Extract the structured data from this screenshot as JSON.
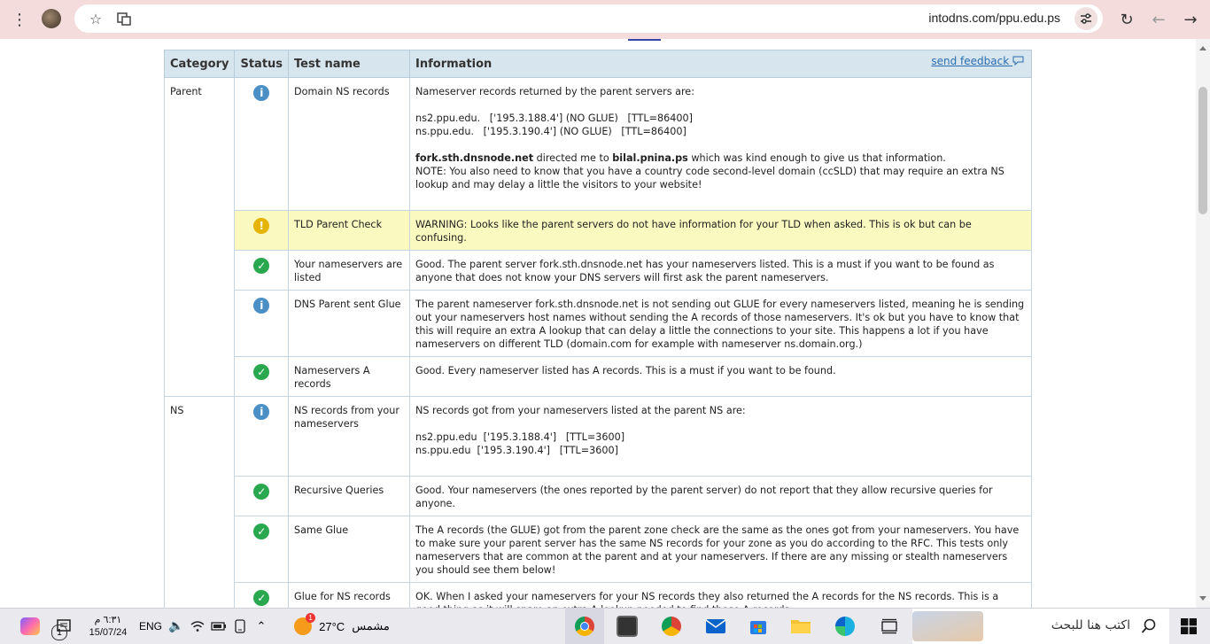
{
  "browser": {
    "url": "intodns.com/ppu.edu.ps"
  },
  "table": {
    "headers": {
      "category": "Category",
      "status": "Status",
      "test": "Test name",
      "info": "Information"
    },
    "feedback_link": "send feedback",
    "rows": [
      {
        "category": "Parent",
        "status": "info",
        "test": "Domain NS records",
        "lines": [
          "Nameserver records returned by the parent servers are:",
          "",
          "ns2.ppu.edu.   ['195.3.188.4'] (NO GLUE)   [TTL=86400]",
          "ns.ppu.edu.   ['195.3.190.4'] (NO GLUE)   [TTL=86400]",
          ""
        ],
        "directed": {
          "server": "fork.sth.dnsnode.net",
          "middle": " directed me to ",
          "target": "bilal.pnina.ps",
          "tail": " which was kind enough to give us that information."
        },
        "note": "NOTE: You also need to know that you have a country code second-level domain (ccSLD) that may require an extra NS lookup and may delay a little the visitors to your website!"
      },
      {
        "category": "",
        "status": "warn",
        "test": "TLD Parent Check",
        "text": "WARNING: Looks like the parent servers do not have information for your TLD when asked. This is ok but can be confusing."
      },
      {
        "category": "",
        "status": "ok",
        "test": "Your nameservers are listed",
        "text": "Good. The parent server fork.sth.dnsnode.net has your nameservers listed. This is a must if you want to be found as anyone that does not know your DNS servers will first ask the parent nameservers."
      },
      {
        "category": "",
        "status": "info",
        "test": "DNS Parent sent Glue",
        "text": "The parent nameserver fork.sth.dnsnode.net is not sending out GLUE for every nameservers listed, meaning he is sending out your nameservers host names without sending the A records of those nameservers. It's ok but you have to know that this will require an extra A lookup that can delay a little the connections to your site. This happens a lot if you have nameservers on different TLD (domain.com for example with nameserver ns.domain.org.)"
      },
      {
        "category": "",
        "status": "ok",
        "test": "Nameservers A records",
        "text": "Good. Every nameserver listed has A records. This is a must if you want to be found."
      },
      {
        "category": "NS",
        "status": "info",
        "test": "NS records from your nameservers",
        "lines": [
          "NS records got from your nameservers listed at the parent NS are:",
          "",
          "ns2.ppu.edu  ['195.3.188.4']   [TTL=3600]",
          "ns.ppu.edu  ['195.3.190.4']   [TTL=3600]"
        ]
      },
      {
        "category": "",
        "status": "ok",
        "test": "Recursive Queries",
        "text": "Good. Your nameservers (the ones reported by the parent server) do not report that they allow recursive queries for anyone."
      },
      {
        "category": "",
        "status": "ok",
        "test": "Same Glue",
        "text": "The A records (the GLUE) got from the parent zone check are the same as the ones got from your nameservers. You have to make sure your parent server has the same NS records for your zone as you do according to the RFC. This tests only nameservers that are common at the parent and at your nameservers. If there are any missing or stealth nameservers you should see them below!"
      },
      {
        "category": "",
        "status": "ok",
        "test": "Glue for NS records",
        "text": "OK. When I asked your nameservers for your NS records they also returned the A records for the NS records. This is a good thing as it will spare an extra A lookup needed to find those A records."
      }
    ]
  },
  "taskbar": {
    "search_placeholder": "اكتب هنا للبحث",
    "weather_temp": "27°C",
    "weather_label": "مشمس",
    "weather_badge": "1",
    "lang": "ENG",
    "time": "٦:٣١ م",
    "date": "15/07/24",
    "notification_count": "1"
  }
}
